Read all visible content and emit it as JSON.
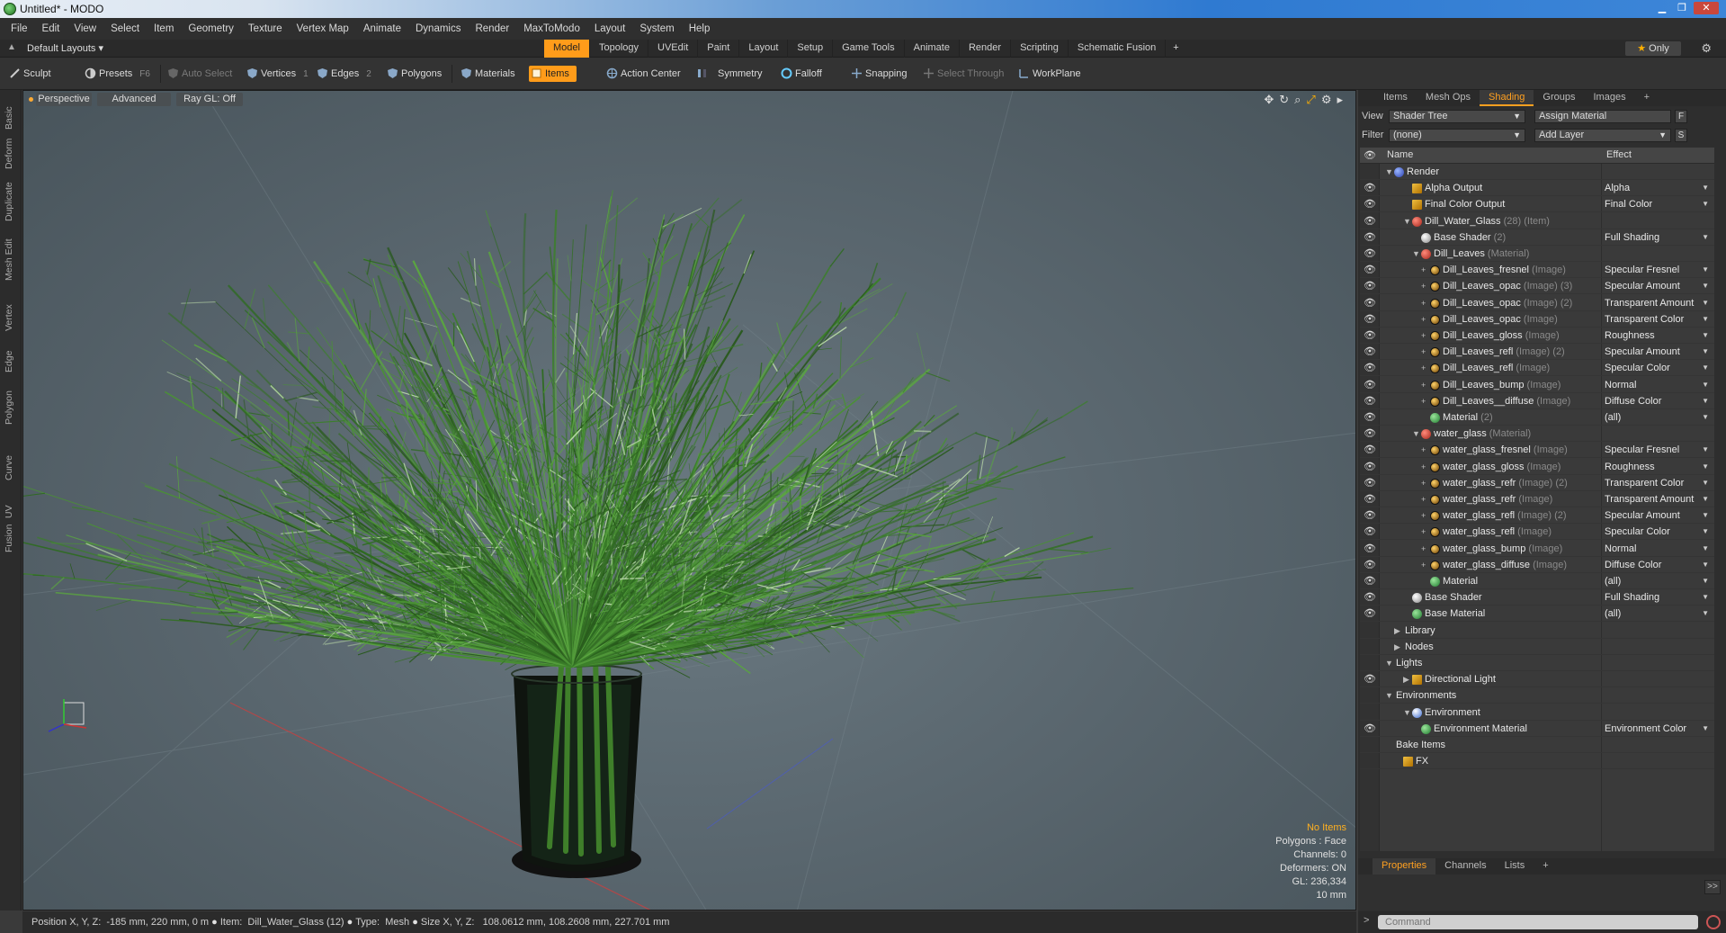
{
  "window": {
    "title": "Untitled* - MODO"
  },
  "menu": [
    "File",
    "Edit",
    "View",
    "Select",
    "Item",
    "Geometry",
    "Texture",
    "Vertex Map",
    "Animate",
    "Dynamics",
    "Render",
    "MaxToModo",
    "Layout",
    "System",
    "Help"
  ],
  "layoutbar": {
    "layout": "Default Layouts ▾",
    "tabs": [
      "Model",
      "Topology",
      "UVEdit",
      "Paint",
      "Layout",
      "Setup",
      "Game Tools",
      "Animate",
      "Render",
      "Scripting",
      "Schematic Fusion"
    ],
    "active_tab": "Model",
    "plus": "+",
    "only_label": "Only"
  },
  "toolbar": {
    "sculpt": "Sculpt",
    "presets": "Presets",
    "presets_key": "F6",
    "auto_select": "Auto Select",
    "vertices": "Vertices",
    "vertices_key": "1",
    "edges": "Edges",
    "edges_key": "2",
    "polygons": "Polygons",
    "materials": "Materials",
    "items": "Items",
    "action_center": "Action Center",
    "symmetry": "Symmetry",
    "falloff": "Falloff",
    "snapping": "Snapping",
    "select_through": "Select Through",
    "workplane": "WorkPlane"
  },
  "left_tabs": [
    "Basic",
    "Deform",
    "Duplicate",
    "Mesh Edit",
    "Vertex",
    "Edge",
    "Polygon",
    "Curve",
    "UV",
    "Fusion"
  ],
  "viewport": {
    "view": "Perspective",
    "mode": "Advanced",
    "raygl": "Ray GL: Off",
    "info": {
      "no_items": "No Items",
      "polygons": "Polygons : Face",
      "channels": "Channels: 0",
      "deformers": "Deformers: ON",
      "gl": "GL: 236,334",
      "scale": "10 mm"
    }
  },
  "statusbar": {
    "position_label": "Position X, Y, Z:",
    "position": "-185 mm, 220 mm, 0 m",
    "item_label": "Item:",
    "item": "Dill_Water_Glass (12)",
    "type_label": "Type:",
    "type": "Mesh",
    "size_label": "Size X, Y, Z:",
    "size": "108.0612 mm, 108.2608 mm, 227.701 mm"
  },
  "rightpanel": {
    "tabs": [
      "Items",
      "Mesh Ops",
      "Shading",
      "Groups",
      "Images"
    ],
    "active_tab": "Shading",
    "plus": "+",
    "view_label": "View",
    "view_value": "Shader Tree",
    "assign_material": "Assign Material",
    "f_btn": "F",
    "filter_label": "Filter",
    "filter_value": "(none)",
    "add_layer": "Add Layer",
    "s_btn": "S",
    "col_name": "Name",
    "col_effect": "Effect",
    "tree": [
      {
        "name": "Render",
        "sub": "",
        "effect": "",
        "indent": 0,
        "icon": "ic-blue",
        "exp": "▼",
        "eye": false
      },
      {
        "name": "Alpha Output",
        "sub": "",
        "effect": "Alpha",
        "indent": 2,
        "icon": "ic-sq",
        "exp": "",
        "eye": true
      },
      {
        "name": "Final Color Output",
        "sub": "",
        "effect": "Final Color",
        "indent": 2,
        "icon": "ic-sq",
        "exp": "",
        "eye": true
      },
      {
        "name": "Dill_Water_Glass",
        "sub": " (28) (Item)",
        "effect": "",
        "indent": 2,
        "icon": "ic-red",
        "exp": "▼",
        "eye": true
      },
      {
        "name": "Base Shader",
        "sub": " (2)",
        "effect": "Full Shading",
        "indent": 3,
        "icon": "ic-white",
        "exp": "",
        "eye": true
      },
      {
        "name": "Dill_Leaves",
        "sub": " (Material)",
        "effect": "",
        "indent": 3,
        "icon": "ic-red",
        "exp": "▼",
        "eye": true
      },
      {
        "name": "Dill_Leaves_fresnel",
        "sub": " (Image)",
        "effect": "Specular Fresnel",
        "indent": 4,
        "icon": "ic-img",
        "exp": "+",
        "eye": true
      },
      {
        "name": "Dill_Leaves_opac",
        "sub": " (Image) (3)",
        "effect": "Specular Amount",
        "indent": 4,
        "icon": "ic-img",
        "exp": "+",
        "eye": true
      },
      {
        "name": "Dill_Leaves_opac",
        "sub": " (Image) (2)",
        "effect": "Transparent Amount",
        "indent": 4,
        "icon": "ic-img",
        "exp": "+",
        "eye": true
      },
      {
        "name": "Dill_Leaves_opac",
        "sub": " (Image)",
        "effect": "Transparent Color",
        "indent": 4,
        "icon": "ic-img",
        "exp": "+",
        "eye": true
      },
      {
        "name": "Dill_Leaves_gloss",
        "sub": " (Image)",
        "effect": "Roughness",
        "indent": 4,
        "icon": "ic-img",
        "exp": "+",
        "eye": true
      },
      {
        "name": "Dill_Leaves_refl",
        "sub": " (Image) (2)",
        "effect": "Specular Amount",
        "indent": 4,
        "icon": "ic-img",
        "exp": "+",
        "eye": true
      },
      {
        "name": "Dill_Leaves_refl",
        "sub": " (Image)",
        "effect": "Specular Color",
        "indent": 4,
        "icon": "ic-img",
        "exp": "+",
        "eye": true
      },
      {
        "name": "Dill_Leaves_bump",
        "sub": " (Image)",
        "effect": "Normal",
        "indent": 4,
        "icon": "ic-img",
        "exp": "+",
        "eye": true
      },
      {
        "name": "Dill_Leaves__diffuse",
        "sub": " (Image)",
        "effect": "Diffuse Color",
        "indent": 4,
        "icon": "ic-img",
        "exp": "+",
        "eye": true
      },
      {
        "name": "Material",
        "sub": " (2)",
        "effect": "(all)",
        "indent": 4,
        "icon": "ic-green",
        "exp": "",
        "eye": true
      },
      {
        "name": "water_glass",
        "sub": " (Material)",
        "effect": "",
        "indent": 3,
        "icon": "ic-red",
        "exp": "▼",
        "eye": true
      },
      {
        "name": "water_glass_fresnel",
        "sub": " (Image)",
        "effect": "Specular Fresnel",
        "indent": 4,
        "icon": "ic-img",
        "exp": "+",
        "eye": true
      },
      {
        "name": "water_glass_gloss",
        "sub": " (Image)",
        "effect": "Roughness",
        "indent": 4,
        "icon": "ic-img",
        "exp": "+",
        "eye": true
      },
      {
        "name": "water_glass_refr",
        "sub": " (Image) (2)",
        "effect": "Transparent Color",
        "indent": 4,
        "icon": "ic-img",
        "exp": "+",
        "eye": true
      },
      {
        "name": "water_glass_refr",
        "sub": " (Image)",
        "effect": "Transparent Amount",
        "indent": 4,
        "icon": "ic-img",
        "exp": "+",
        "eye": true
      },
      {
        "name": "water_glass_refl",
        "sub": " (Image) (2)",
        "effect": "Specular Amount",
        "indent": 4,
        "icon": "ic-img",
        "exp": "+",
        "eye": true
      },
      {
        "name": "water_glass_refl",
        "sub": " (Image)",
        "effect": "Specular Color",
        "indent": 4,
        "icon": "ic-img",
        "exp": "+",
        "eye": true
      },
      {
        "name": "water_glass_bump",
        "sub": " (Image)",
        "effect": "Normal",
        "indent": 4,
        "icon": "ic-img",
        "exp": "+",
        "eye": true
      },
      {
        "name": "water_glass_diffuse",
        "sub": " (Image)",
        "effect": "Diffuse Color",
        "indent": 4,
        "icon": "ic-img",
        "exp": "+",
        "eye": true
      },
      {
        "name": "Material",
        "sub": "",
        "effect": "(all)",
        "indent": 4,
        "icon": "ic-green",
        "exp": "",
        "eye": true
      },
      {
        "name": "Base Shader",
        "sub": "",
        "effect": "Full Shading",
        "indent": 2,
        "icon": "ic-white",
        "exp": "",
        "eye": true
      },
      {
        "name": "Base Material",
        "sub": "",
        "effect": "(all)",
        "indent": 2,
        "icon": "ic-green",
        "exp": "",
        "eye": true
      },
      {
        "name": "Library",
        "sub": "",
        "effect": "",
        "indent": 1,
        "icon": "",
        "exp": "▶",
        "eye": false
      },
      {
        "name": "Nodes",
        "sub": "",
        "effect": "",
        "indent": 1,
        "icon": "",
        "exp": "▶",
        "eye": false
      },
      {
        "name": "Lights",
        "sub": "",
        "effect": "",
        "indent": 0,
        "icon": "",
        "exp": "▼",
        "eye": false
      },
      {
        "name": "Directional Light",
        "sub": "",
        "effect": "",
        "indent": 2,
        "icon": "ic-sq",
        "exp": "▶",
        "eye": true
      },
      {
        "name": "Environments",
        "sub": "",
        "effect": "",
        "indent": 0,
        "icon": "",
        "exp": "▼",
        "eye": false
      },
      {
        "name": "Environment",
        "sub": "",
        "effect": "",
        "indent": 2,
        "icon": "ic-env",
        "exp": "▼",
        "eye": false
      },
      {
        "name": "Environment Material",
        "sub": "",
        "effect": "Environment Color",
        "indent": 3,
        "icon": "ic-green",
        "exp": "",
        "eye": true
      },
      {
        "name": "Bake Items",
        "sub": "",
        "effect": "",
        "indent": 0,
        "icon": "",
        "exp": "",
        "eye": false
      },
      {
        "name": "FX",
        "sub": "",
        "effect": "",
        "indent": 1,
        "icon": "ic-sq",
        "exp": "",
        "eye": false
      }
    ],
    "bottom_tabs": [
      "Properties",
      "Channels",
      "Lists"
    ],
    "bottom_active": "Properties",
    "expand_btn": ">>",
    "command_placeholder": "Command"
  }
}
